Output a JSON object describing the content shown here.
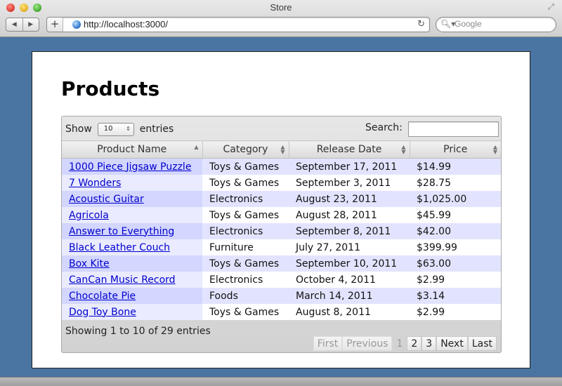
{
  "window": {
    "title": "Store"
  },
  "toolbar": {
    "add_label": "+",
    "url": "http://localhost:3000/",
    "search_placeholder": "Google"
  },
  "page": {
    "heading": "Products",
    "length": {
      "show_label": "Show",
      "value": "10",
      "entries_label": "entries"
    },
    "search": {
      "label": "Search:",
      "value": ""
    },
    "columns": [
      "Product Name",
      "Category",
      "Release Date",
      "Price"
    ],
    "rows": [
      [
        "1000 Piece Jigsaw Puzzle",
        "Toys & Games",
        "September 17, 2011",
        "$14.99"
      ],
      [
        "7 Wonders",
        "Toys & Games",
        "September 3, 2011",
        "$28.75"
      ],
      [
        "Acoustic Guitar",
        "Electronics",
        "August 23, 2011",
        "$1,025.00"
      ],
      [
        "Agricola",
        "Toys & Games",
        "August 28, 2011",
        "$45.99"
      ],
      [
        "Answer to Everything",
        "Electronics",
        "September 8, 2011",
        "$42.00"
      ],
      [
        "Black Leather Couch",
        "Furniture",
        "July 27, 2011",
        "$399.99"
      ],
      [
        "Box Kite",
        "Toys & Games",
        "September 10, 2011",
        "$63.00"
      ],
      [
        "CanCan Music Record",
        "Electronics",
        "October 4, 2011",
        "$2.99"
      ],
      [
        "Chocolate Pie",
        "Foods",
        "March 14, 2011",
        "$3.14"
      ],
      [
        "Dog Toy Bone",
        "Toys & Games",
        "August 8, 2011",
        "$2.99"
      ]
    ],
    "info": "Showing 1 to 10 of 29 entries",
    "pagination": {
      "first": "First",
      "previous": "Previous",
      "pages": [
        "1",
        "2",
        "3"
      ],
      "next": "Next",
      "last": "Last"
    }
  }
}
